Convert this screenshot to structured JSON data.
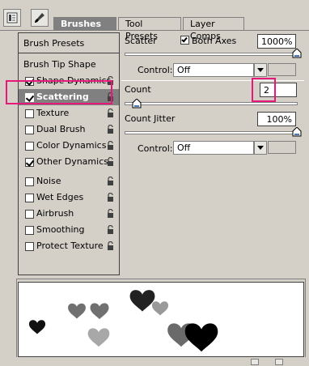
{
  "tabs": [
    {
      "label": "Brushes",
      "active": true
    },
    {
      "label": "Tool Presets",
      "active": false
    },
    {
      "label": "Layer Comps",
      "active": false
    }
  ],
  "left_panel": {
    "header": "Brush Presets",
    "title_item": "Brush Tip Shape",
    "items": [
      {
        "label": "Shape Dynamics",
        "checked": true,
        "selected": false
      },
      {
        "label": "Scattering",
        "checked": true,
        "selected": true
      },
      {
        "label": "Texture",
        "checked": false,
        "selected": false
      },
      {
        "label": "Dual Brush",
        "checked": false,
        "selected": false
      },
      {
        "label": "Color Dynamics",
        "checked": false,
        "selected": false
      },
      {
        "label": "Other Dynamics",
        "checked": true,
        "selected": false
      },
      {
        "label": "Noise",
        "checked": false,
        "selected": false
      },
      {
        "label": "Wet Edges",
        "checked": false,
        "selected": false
      },
      {
        "label": "Airbrush",
        "checked": false,
        "selected": false
      },
      {
        "label": "Smoothing",
        "checked": false,
        "selected": false
      },
      {
        "label": "Protect Texture",
        "checked": false,
        "selected": false
      }
    ]
  },
  "options": {
    "scatter_label": "Scatter",
    "both_axes_label": "Both Axes",
    "both_axes_checked": true,
    "scatter_value": "1000%",
    "scatter_slider_level": 1.0,
    "control1_label": "Control:",
    "control1_value": "Off",
    "count_label": "Count",
    "count_value": "2",
    "count_slider_level": 0.07,
    "count_jitter_label": "Count Jitter",
    "count_jitter_value": "100%",
    "count_jitter_slider_level": 1.0,
    "control2_label": "Control:",
    "control2_value": "Off"
  },
  "colors": {
    "highlight": "#e6197a",
    "selected_row": "#808080",
    "panel_bg": "#d4d0c8"
  }
}
